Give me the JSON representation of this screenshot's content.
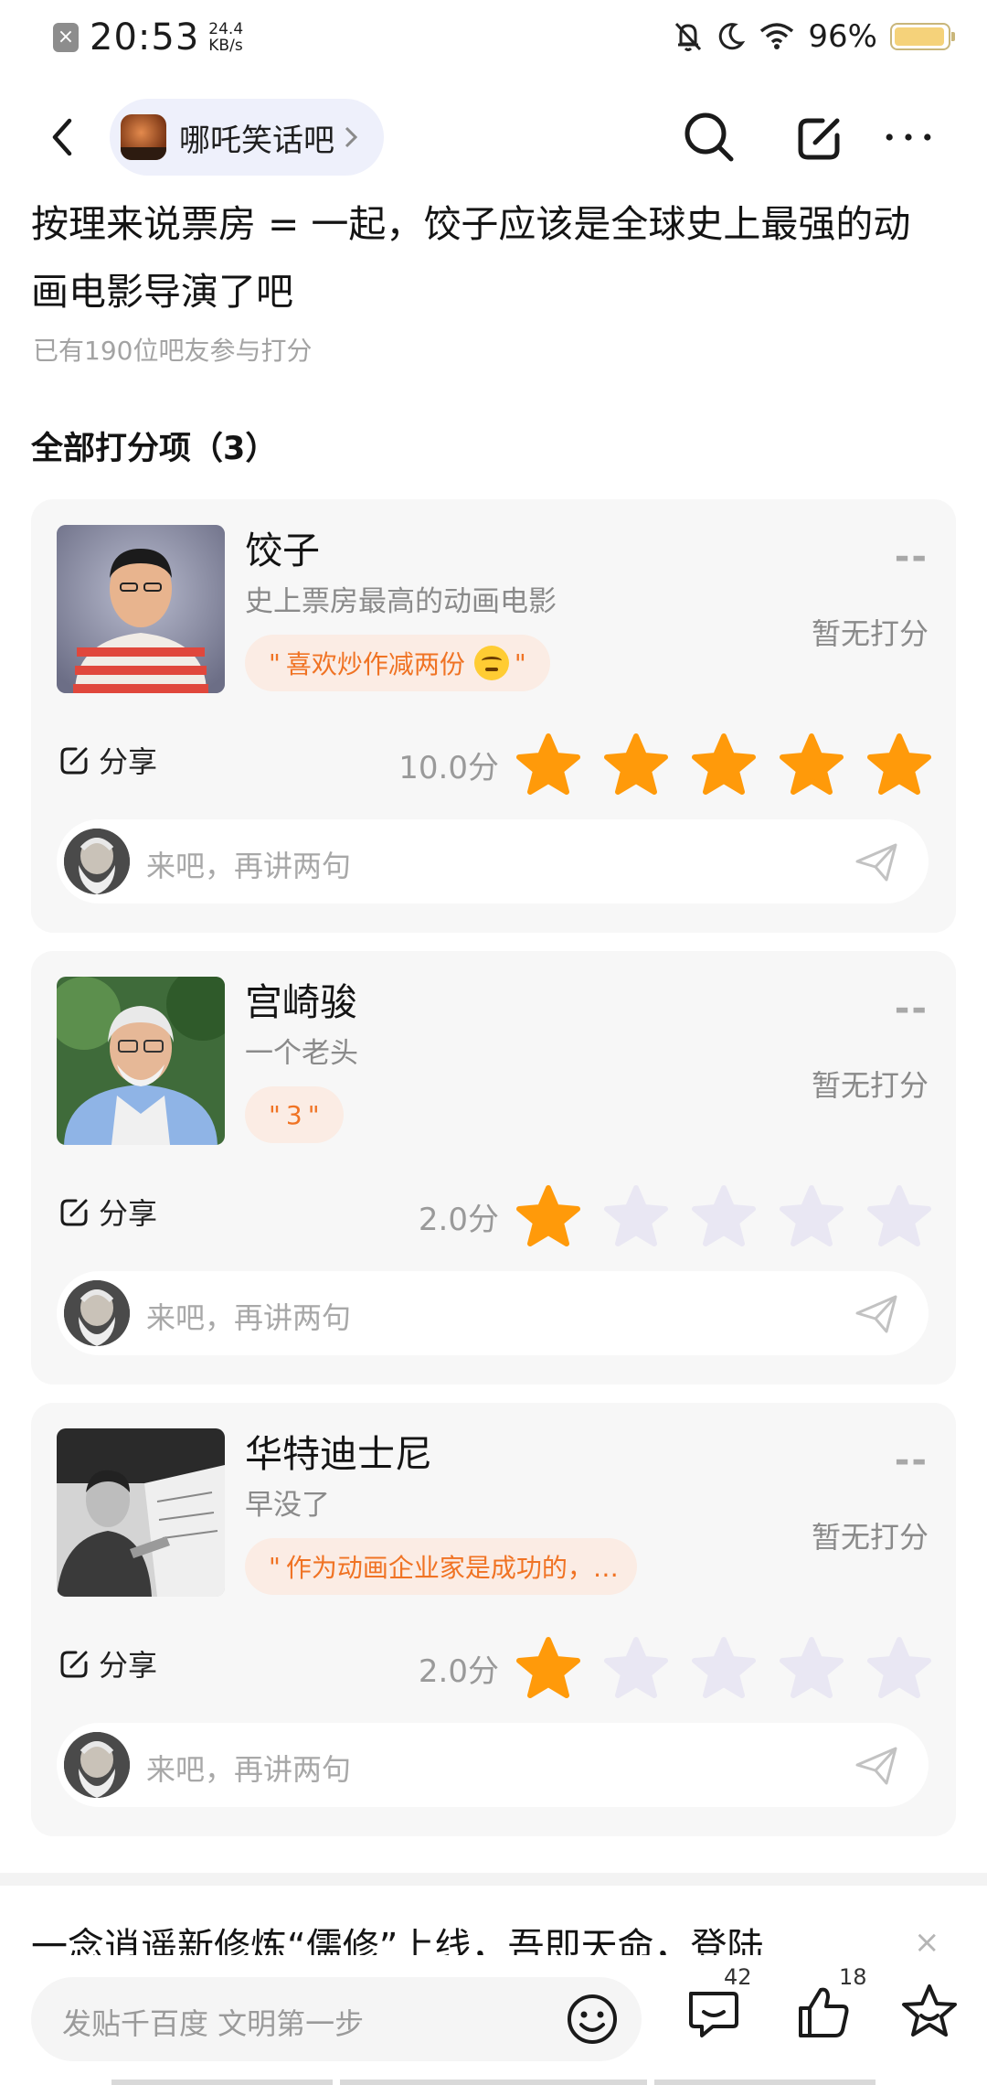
{
  "status_bar": {
    "close_glyph": "×",
    "time": "20:53",
    "speed_value": "24.4",
    "speed_unit": "KB/s",
    "battery_percent": "96%",
    "battery_level": 0.96,
    "icons": [
      "mute-bell-icon",
      "moon-icon",
      "wifi-icon",
      "battery-icon"
    ]
  },
  "nav": {
    "forum_name": "哪吒笑话吧",
    "icons": [
      "back-arrow-icon",
      "search-icon",
      "edit-share-icon",
      "more-dots-icon"
    ]
  },
  "post": {
    "title": "按理来说票房 = 一起，饺子应该是全球史上最强的动画电影导演了吧",
    "participants": "已有190位吧友参与打分"
  },
  "section": {
    "title": "全部打分项（3）"
  },
  "cards": [
    {
      "name": "饺子",
      "desc": "史上票房最高的动画电影",
      "comment": "喜欢炒作减两份",
      "comment_emoji": "thinking-face-icon",
      "dash": "--",
      "no_score": "暂无打分",
      "share_label": "分享",
      "score": "10.0分",
      "rating": 5,
      "reply_placeholder": "来吧，再讲两句"
    },
    {
      "name": "宫崎骏",
      "desc": "一个老头",
      "comment": "3",
      "dash": "--",
      "no_score": "暂无打分",
      "share_label": "分享",
      "score": "2.0分",
      "rating": 1,
      "reply_placeholder": "来吧，再讲两句"
    },
    {
      "name": "华特迪士尼",
      "desc": "早没了",
      "comment": "作为动画企业家是成功的，…",
      "dash": "--",
      "no_score": "暂无打分",
      "share_label": "分享",
      "score": "2.0分",
      "rating": 1,
      "reply_placeholder": "来吧，再讲两句"
    }
  ],
  "ad": {
    "title": "一念逍遥新修炼“儒修”上线，吾即天命，登陆",
    "close": "×"
  },
  "bottom_bar": {
    "post_placeholder": "发贴千百度 文明第一步",
    "comment_count": "42",
    "like_count": "18",
    "icons": [
      "emoji-icon",
      "comment-icon",
      "like-icon",
      "favorite-star-icon"
    ]
  },
  "colors": {
    "star_active": "#ff9a0a",
    "star_inactive": "#e9e7f3",
    "comment_tag_bg": "#fbece4",
    "comment_tag_text": "#f07324",
    "forum_chip_bg": "#eef0fb"
  }
}
